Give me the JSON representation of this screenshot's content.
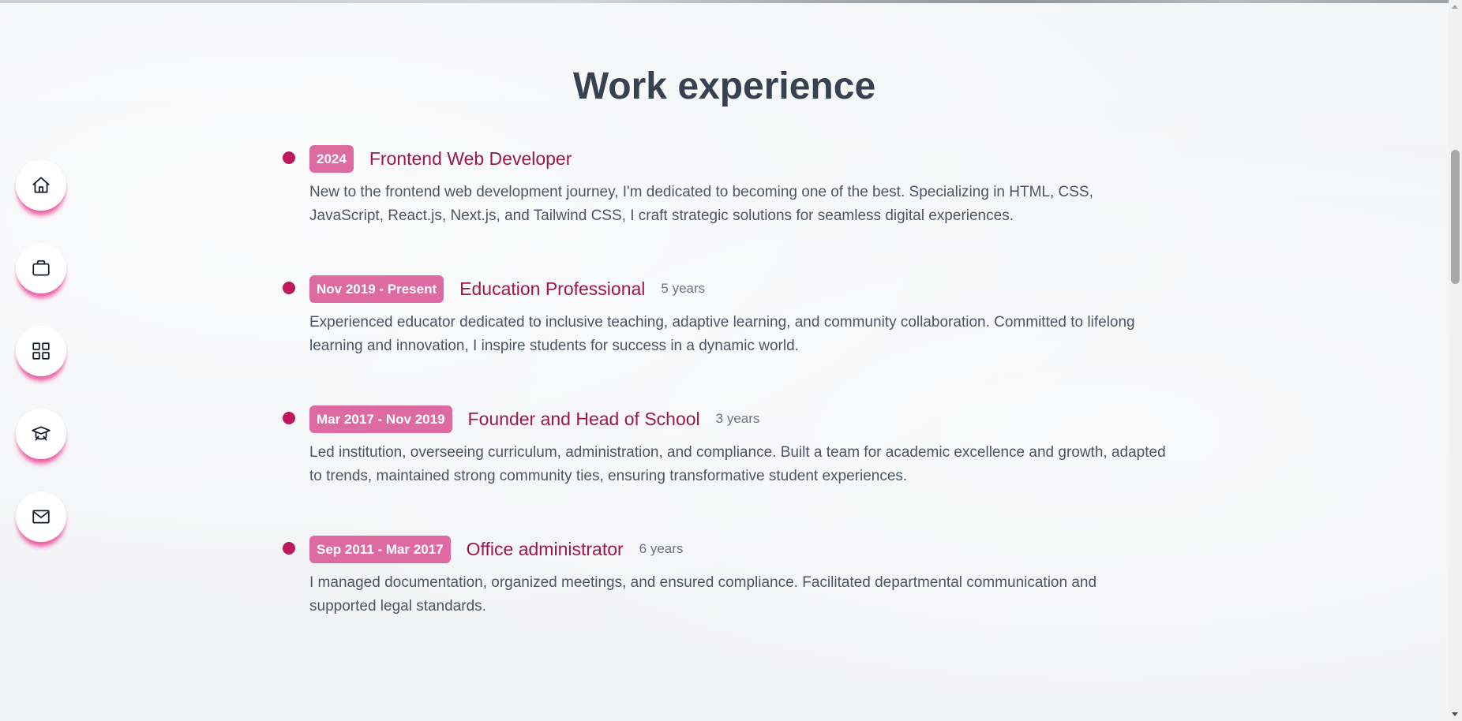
{
  "section": {
    "title": "Work experience"
  },
  "experience": [
    {
      "period": "2024",
      "role": "Frontend Web Developer",
      "duration": "",
      "description": "New to the frontend web development journey, I'm dedicated to becoming one of the best. Specializing in HTML, CSS, JavaScript, React.js, Next.js, and Tailwind CSS, I craft strategic solutions for seamless digital experiences."
    },
    {
      "period": "Nov 2019 - Present",
      "role": "Education Professional",
      "duration": "5 years",
      "description": "Experienced educator dedicated to inclusive teaching, adaptive learning, and community collaboration. Committed to lifelong learning and innovation, I inspire students for success in a dynamic world."
    },
    {
      "period": "Mar 2017 - Nov 2019",
      "role": "Founder and Head of School",
      "duration": "3 years",
      "description": "Led institution, overseeing curriculum, administration, and compliance. Built a team for academic excellence and growth, adapted to trends, maintained strong community ties, ensuring transformative student experiences."
    },
    {
      "period": "Sep 2011 - Mar 2017",
      "role": "Office administrator",
      "duration": "6 years",
      "description": "I managed documentation, organized meetings, and ensured compliance. Facilitated departmental communication and supported legal standards."
    }
  ],
  "nav": {
    "items": [
      {
        "icon": "home-icon"
      },
      {
        "icon": "briefcase-icon"
      },
      {
        "icon": "grid-icon"
      },
      {
        "icon": "graduation-cap-icon"
      },
      {
        "icon": "mail-icon"
      }
    ]
  },
  "colors": {
    "accent": "#be185d",
    "badge": "#de6aa2",
    "role": "#9d174d",
    "title": "#374151",
    "shadow": "#ec4899"
  }
}
